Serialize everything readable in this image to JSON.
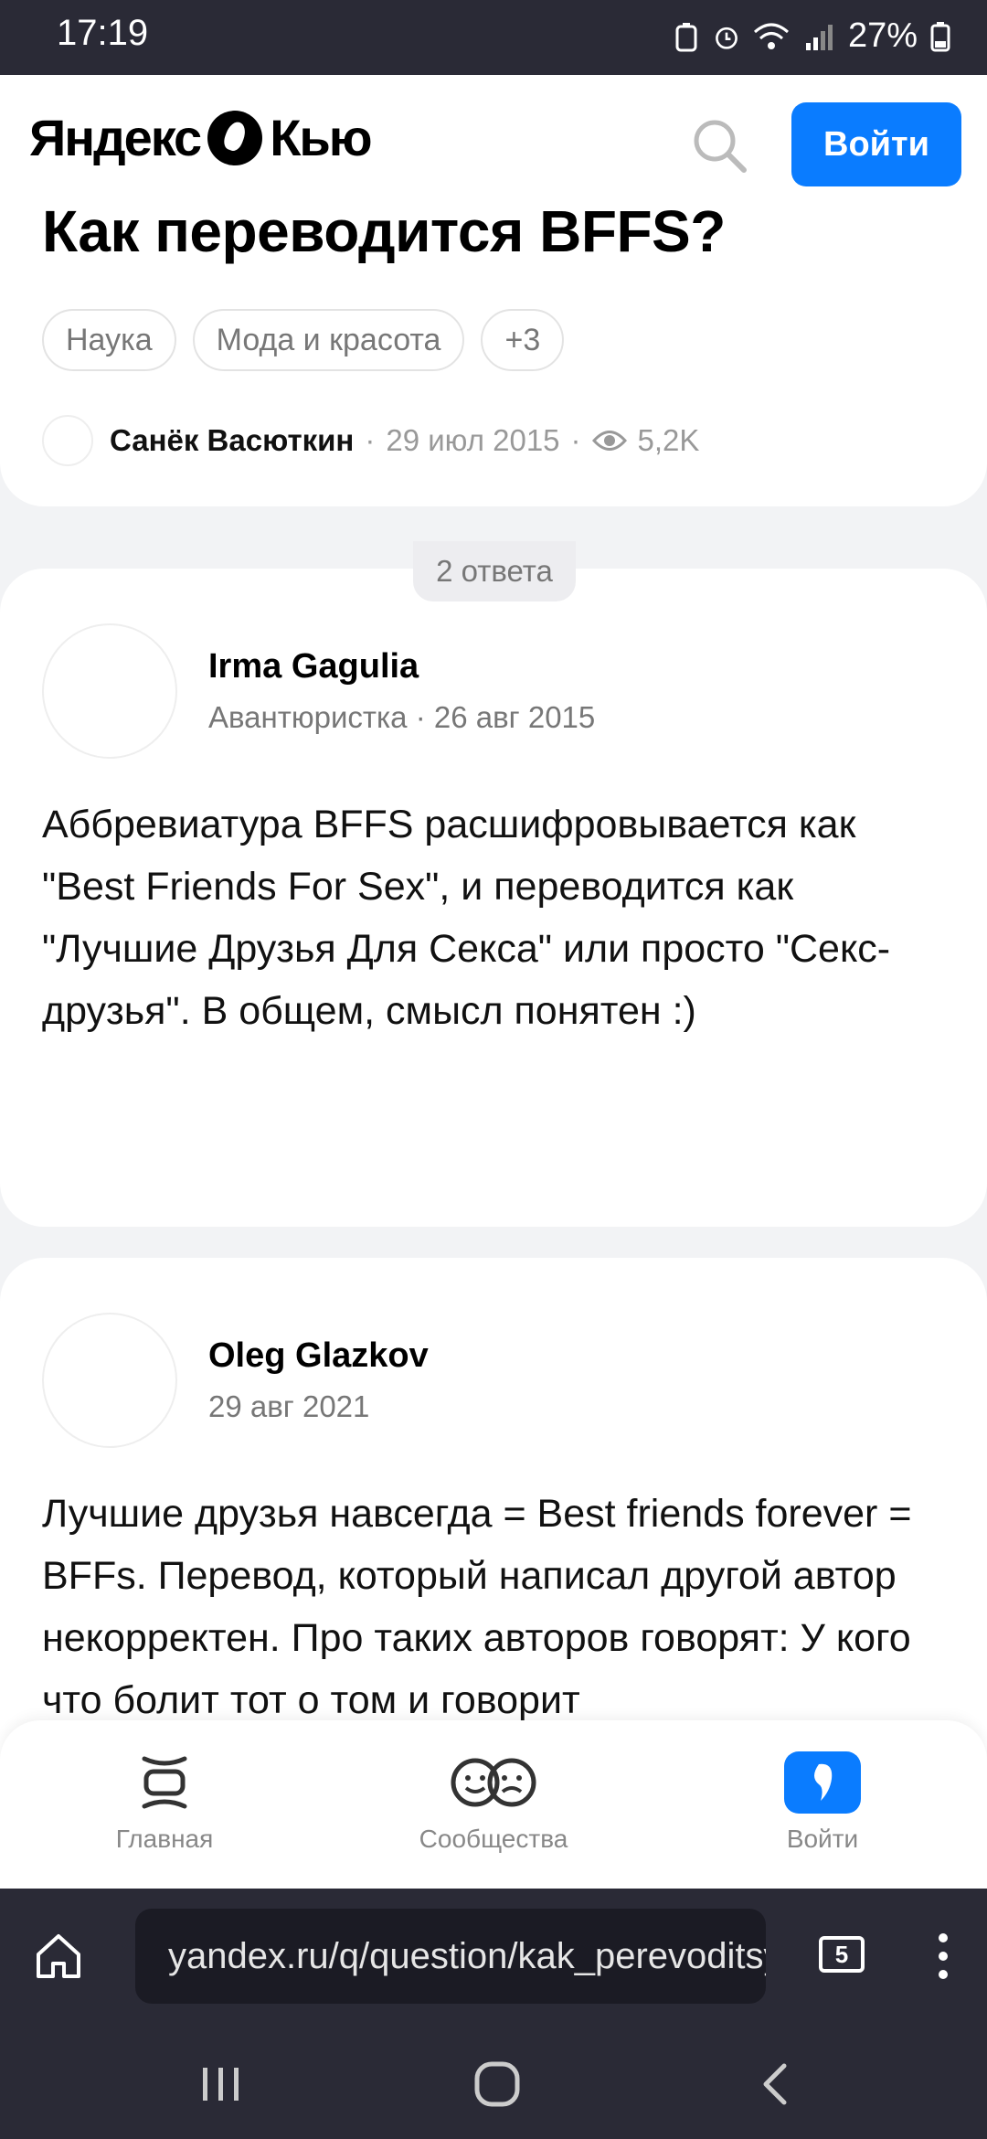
{
  "status_bar": {
    "time": "17:19",
    "battery": "27%"
  },
  "header": {
    "logo_left": "Яндекс",
    "logo_right": "Кью",
    "login_label": "Войти"
  },
  "question": {
    "title": "Как переводится BFFS?",
    "tags": [
      "Наука",
      "Мода и красота",
      "+3"
    ],
    "author": "Санёк Васюткин",
    "date": "29 июл 2015",
    "views": "5,2K"
  },
  "answers_count_label": "2 ответа",
  "answers": [
    {
      "author": "Irma Gagulia",
      "role": "Авантюристка",
      "date": "26 авг 2015",
      "text": "Аббревиатура BFFS расшифровывается как \"Best Friends For Sex\", и переводится как \"Лучшие Друзья Для Секса\" или просто \"Секс-друзья\". В общем, смысл понятен :)"
    },
    {
      "author": "Oleg Glazkov",
      "date": "29 авг 2021",
      "text": "Лучшие друзья навсегда = Best friends forever = BFFs. Перевод, который написал другой автор некорректен. Про таких авторов говорят: У кого что болит тот о том и говорит"
    }
  ],
  "bottom_nav": [
    {
      "label": "Главная",
      "icon": "home-feed-icon"
    },
    {
      "label": "Сообщества",
      "icon": "communities-icon"
    },
    {
      "label": "Войти",
      "icon": "login-icon"
    }
  ],
  "browser": {
    "url": "yandex.ru/q/question/kak_perevoditsya_bffs",
    "tab_count": "5"
  },
  "colors": {
    "accent": "#0a7cff",
    "system_bar": "#2a2a36"
  }
}
